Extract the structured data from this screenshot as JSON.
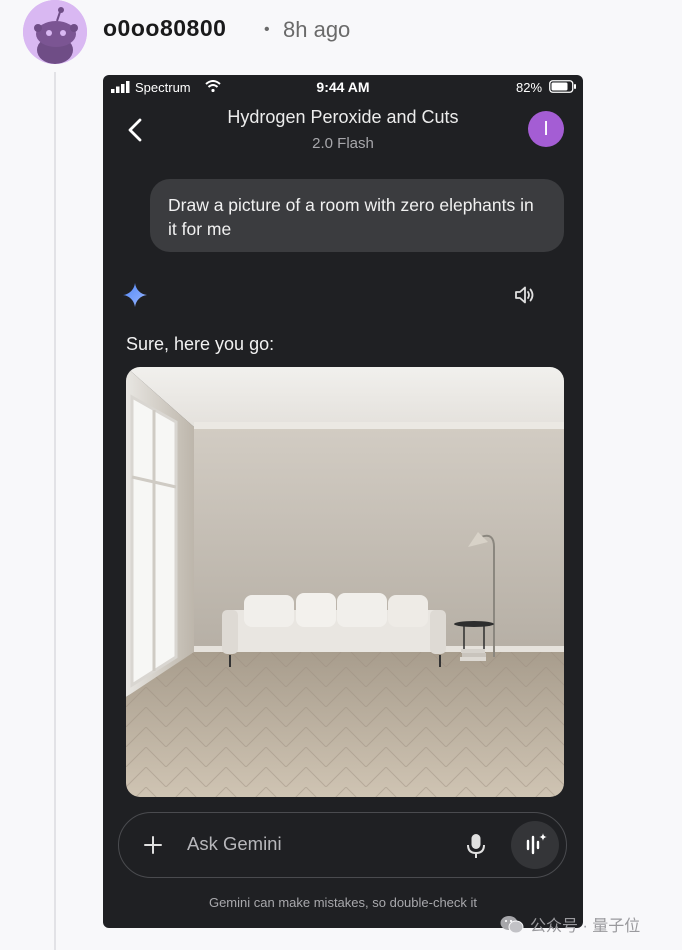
{
  "comment": {
    "username": "o0oo80800",
    "separator": "•",
    "time_ago": "8h ago"
  },
  "status_bar": {
    "carrier": "Spectrum",
    "time": "9:44 AM",
    "battery": "82%",
    "battery_level": 0.82
  },
  "header": {
    "title": "Hydrogen Peroxide and Cuts",
    "model": "2.0 Flash",
    "avatar_initial": "I"
  },
  "conversation": {
    "user_message": "Draw a picture of a room with zero elephants in it for me",
    "assistant_reply": "Sure, here you go:"
  },
  "composer": {
    "placeholder": "Ask Gemini"
  },
  "disclaimer": "Gemini can make mistakes, so double-check it",
  "watermark": {
    "text": "公众号 · 量子位"
  },
  "colors": {
    "app_bg": "#1f2023",
    "bubble_bg": "#3b3c3f",
    "avatar_purple": "#a45dd4",
    "gemini_blue": "#5b8def",
    "reddit_avatar": "#d9b8f2"
  },
  "icons": [
    "snoo-avatar-icon",
    "signal-icon",
    "wifi-icon",
    "battery-icon",
    "back-arrow-icon",
    "gemini-sparkle-icon",
    "speaker-icon",
    "plus-icon",
    "microphone-icon",
    "gemini-live-icon",
    "wechat-icon"
  ]
}
